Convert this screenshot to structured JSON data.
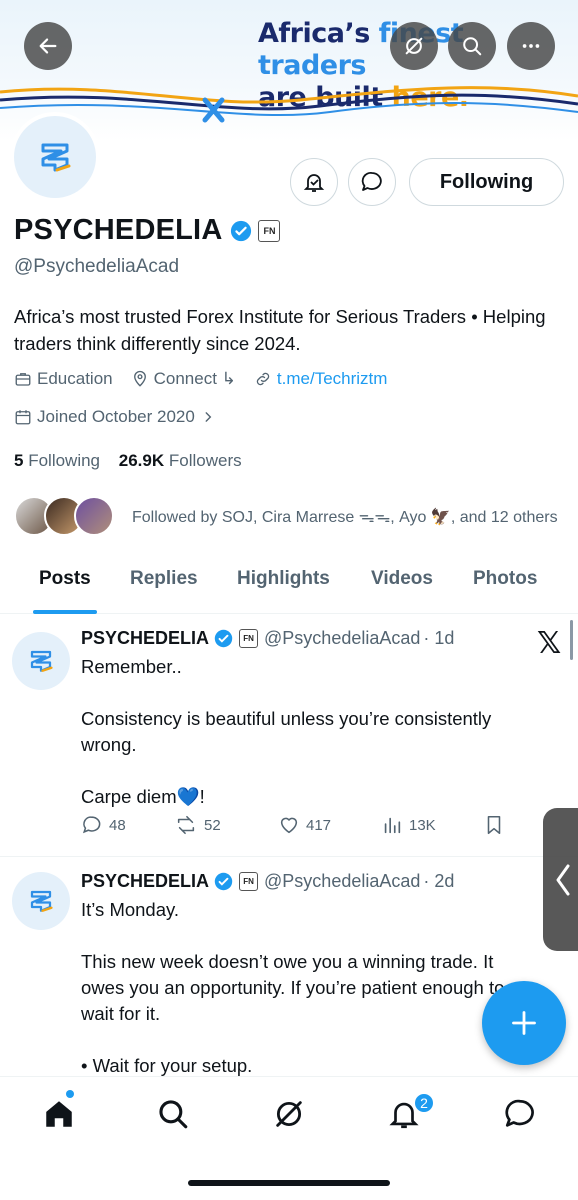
{
  "banner": {
    "line1_a": "Africa’s ",
    "line1_b": "finest traders",
    "line2_a": "are built ",
    "line2_b": "here."
  },
  "profile": {
    "name": "PSYCHEDELIA",
    "fn_badge": "FN",
    "handle": "@PsychedeliaAcad",
    "bio": "Africa’s most trusted Forex Institute for Serious Traders • Helping traders think differently since 2024.",
    "category": "Education",
    "connect": "Connect ↳",
    "link": "t.me/Techriztm",
    "joined": "Joined October 2020",
    "following_count": "5",
    "following_label": "Following",
    "followers_count": "26.9K",
    "followers_label": "Followers",
    "followed_by": "Followed by SOJ, Cira Marrese ᯓᯓ, Ayo 🦅, and 12 others",
    "following_button": "Following"
  },
  "tabs": [
    "Posts",
    "Replies",
    "Highlights",
    "Videos",
    "Photos"
  ],
  "posts": [
    {
      "name": "PSYCHEDELIA",
      "handle": "@PsychedeliaAcad",
      "time": "1d",
      "body": "Remember..\n\nConsistency is beautiful unless you’re consistently wrong.\n\nCarpe diem💙!",
      "replies": "48",
      "reposts": "52",
      "likes": "417",
      "views": "13K"
    },
    {
      "name": "PSYCHEDELIA",
      "handle": "@PsychedeliaAcad",
      "time": "2d",
      "body": "It’s Monday.\n\nThis new week doesn’t owe you a winning trade. It owes you an opportunity. If you’re patient enough to wait for it.\n\n• Wait for your setup.\n• Protect your capital."
    }
  ],
  "nav": {
    "notifications_badge": "2"
  },
  "colors": {
    "accent": "#1d9bf0",
    "text": "#0f1419",
    "muted": "#536471"
  }
}
